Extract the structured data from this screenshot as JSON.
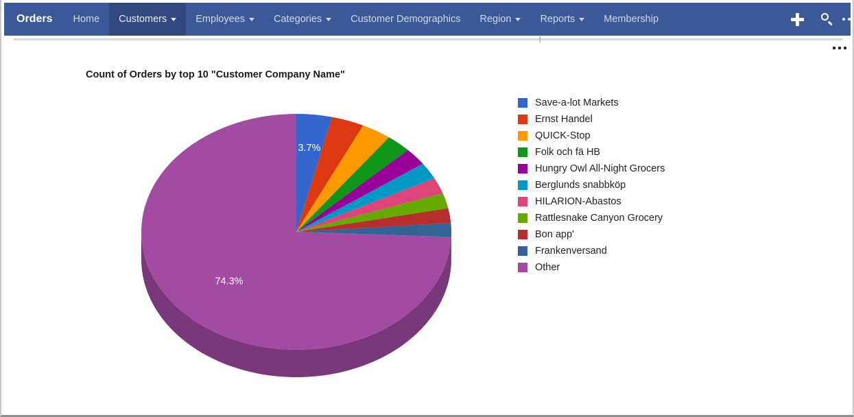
{
  "navbar": {
    "brand": "Orders",
    "items": [
      {
        "label": "Home",
        "has_caret": false,
        "active": false
      },
      {
        "label": "Customers",
        "has_caret": true,
        "active": true
      },
      {
        "label": "Employees",
        "has_caret": true,
        "active": false
      },
      {
        "label": "Categories",
        "has_caret": true,
        "active": false
      },
      {
        "label": "Customer Demographics",
        "has_caret": false,
        "active": false
      },
      {
        "label": "Region",
        "has_caret": true,
        "active": false
      },
      {
        "label": "Reports",
        "has_caret": true,
        "active": false
      },
      {
        "label": "Membership",
        "has_caret": false,
        "active": false
      }
    ],
    "tools": [
      {
        "icon": "plus-icon"
      },
      {
        "icon": "search-icon"
      },
      {
        "icon": "more-horizontal-icon"
      }
    ],
    "background_color": "#3b5998",
    "active_background_color": "#31497e"
  },
  "content": {
    "more_menu_icon": "more-horizontal-icon"
  },
  "chart_data": {
    "type": "pie",
    "title": "Count of Orders by top 10 \"Customer Company Name\"",
    "legend_position": "right",
    "three_d": true,
    "start_angle": 0,
    "direction": "clockwise",
    "categories": [
      "Save-a-lot Markets",
      "Ernst Handel",
      "QUICK-Stop",
      "Folk och fä HB",
      "Hungry Owl All-Night Grocers",
      "Berglunds snabbköp",
      "HILARION-Abastos",
      "Rattlesnake Canyon Grocery",
      "Bon app'",
      "Frankenversand",
      "Other"
    ],
    "values": [
      3.7,
      3.4,
      3.1,
      2.6,
      2.4,
      2.3,
      2.2,
      2.1,
      2.0,
      1.9,
      74.3
    ],
    "value_unit": "%",
    "colors": [
      "#3366cc",
      "#dc3912",
      "#ff9900",
      "#109618",
      "#990099",
      "#0099c6",
      "#dd4477",
      "#66aa00",
      "#b82e2e",
      "#316395",
      "#a34aa3"
    ],
    "side_colors": [
      "#27519f",
      "#a92c0e",
      "#cc7a00",
      "#0d7512",
      "#760076",
      "#00779b",
      "#ad355d",
      "#4f8300",
      "#8d2424",
      "#264c73",
      "#793879"
    ],
    "visible_slice_labels": [
      {
        "category": "Save-a-lot Markets",
        "text": "3.7%"
      },
      {
        "category": "Other",
        "text": "74.3%"
      }
    ],
    "xlabel": "",
    "ylabel": ""
  }
}
